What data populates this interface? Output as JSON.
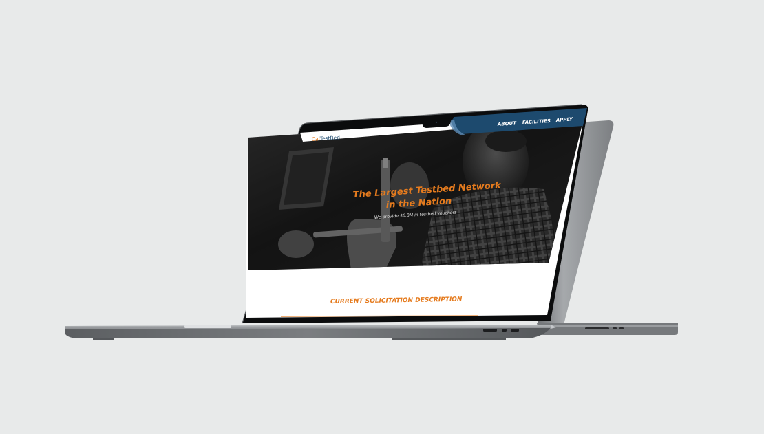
{
  "site": {
    "logo_prefix": "Cal",
    "logo_suffix": "TestBed",
    "nav": [
      {
        "label": "ABOUT"
      },
      {
        "label": "FACILITIES"
      },
      {
        "label": "APPLY"
      }
    ],
    "hero": {
      "headline_line1": "The Largest Testbed Network",
      "headline_line2": "in the Nation",
      "subtext": "We provide $6.8M in testbed vouchers"
    },
    "section_heading": "CURRENT SOLICITATION DESCRIPTION"
  },
  "colors": {
    "background": "#e8eaea",
    "brand_orange": "#e57b1e",
    "nav_blue": "#1d4a6e",
    "laptop_body": "#8a8d90",
    "bezel": "#0b0c0d"
  }
}
